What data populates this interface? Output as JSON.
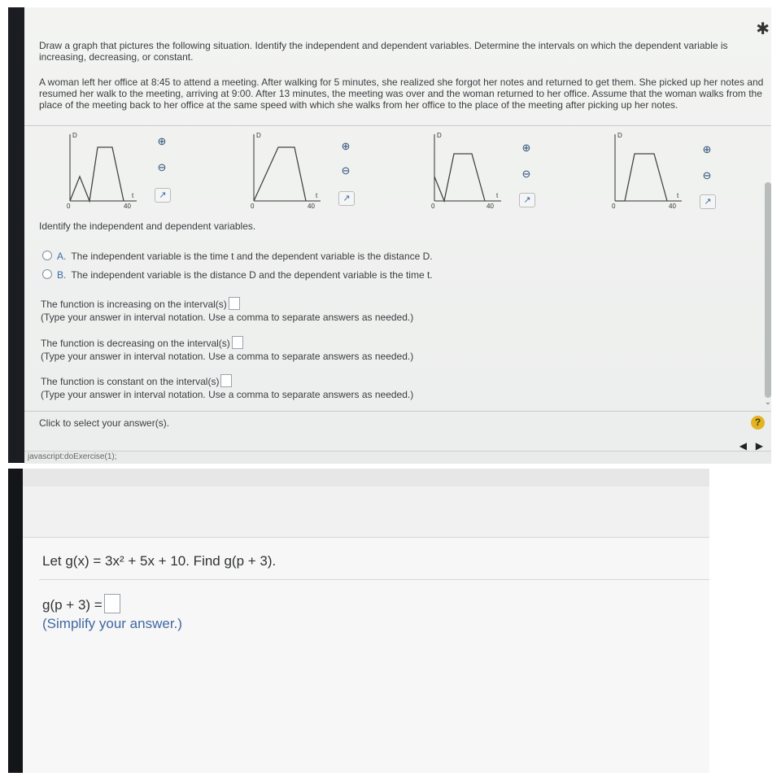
{
  "top": {
    "prompt": "Draw a graph that pictures the following situation. Identify the independent and dependent variables. Determine the intervals on which the dependent variable is increasing, decreasing, or constant.",
    "scenario": "A woman left her office at 8:45 to attend a meeting. After walking for 5 minutes, she realized she forgot her notes and returned to get them. She picked up her notes and resumed her walk to the meeting, arriving at 9:00. After 13 minutes, the meeting was over and the woman returned to her office. Assume that the woman walks from the place of the meeting back to her office at the same speed with which she walks from her office to the place of the meeting after picking up her notes.",
    "graphs": [
      {
        "y_label": "D",
        "x_label": "t",
        "origin": "0",
        "x_tick": "40"
      },
      {
        "y_label": "D",
        "x_label": "t",
        "origin": "0",
        "x_tick": "40"
      },
      {
        "y_label": "D",
        "x_label": "t",
        "origin": "0",
        "x_tick": "40"
      },
      {
        "y_label": "D",
        "x_label": "t",
        "origin": "0",
        "x_tick": "40"
      }
    ],
    "identify_label": "Identify the independent and dependent variables.",
    "options": [
      {
        "letter": "A.",
        "text": "The independent variable is the time t and the dependent variable is the distance D."
      },
      {
        "letter": "B.",
        "text": "The independent variable is the distance D and the dependent variable is the time t."
      }
    ],
    "increasing_label": "The function is increasing on the interval(s)",
    "decreasing_label": "The function is decreasing on the interval(s)",
    "constant_label": "The function is constant on the interval(s)",
    "hint": "(Type your answer in interval notation. Use a comma to separate answers as needed.)",
    "click_prompt": "Click to select your answer(s).",
    "status": "javascript:doExercise(1);",
    "help": "?",
    "gear_icon": "gear-icon",
    "prev": "◀",
    "next": "▶"
  },
  "bottom": {
    "question": "Let g(x) = 3x² + 5x + 10. Find g(p + 3).",
    "answer_label": "g(p + 3) =",
    "hint": "(Simplify your answer.)"
  }
}
